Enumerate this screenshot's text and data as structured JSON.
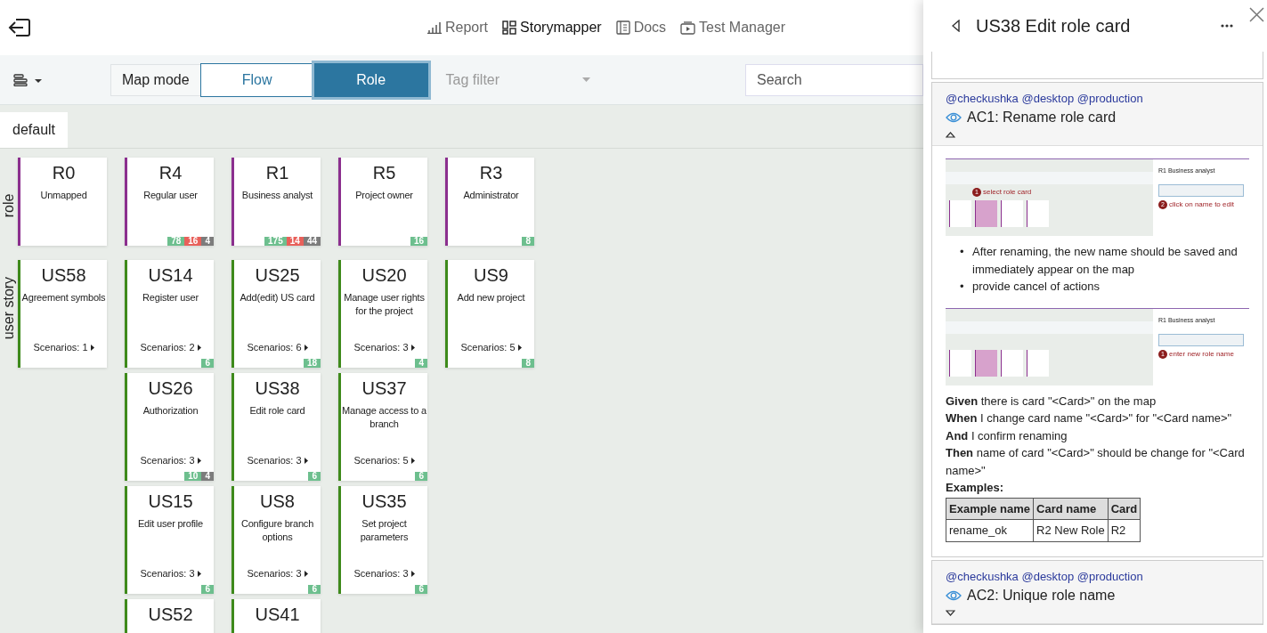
{
  "nav": {
    "links": [
      {
        "label": "Report",
        "selected": false
      },
      {
        "label": "Storymapper",
        "selected": true
      },
      {
        "label": "Docs",
        "selected": false
      },
      {
        "label": "Test Manager",
        "selected": false
      }
    ]
  },
  "toolbar": {
    "map_mode_label": "Map mode",
    "modes": [
      {
        "label": "Flow",
        "selected": false
      },
      {
        "label": "Role",
        "selected": true
      }
    ],
    "tag_filter": {
      "placeholder": "Tag filter"
    },
    "search": {
      "placeholder": "Search"
    }
  },
  "tabs": [
    {
      "label": "default",
      "selected": true
    }
  ],
  "lanes": [
    {
      "label": "role",
      "color": "#8b2f8e",
      "columns": [
        [
          {
            "code": "R0",
            "title": "Unmapped"
          }
        ],
        [
          {
            "code": "R4",
            "title": "Regular user",
            "badges": [
              {
                "kind": "passed",
                "text": "78"
              },
              {
                "kind": "failed",
                "text": "16"
              },
              {
                "kind": "skipped",
                "text": "4"
              }
            ]
          }
        ],
        [
          {
            "code": "R1",
            "title": "Business analyst",
            "badges": [
              {
                "kind": "passed",
                "text": "175"
              },
              {
                "kind": "failed",
                "text": "14"
              },
              {
                "kind": "skipped",
                "text": "44"
              }
            ]
          }
        ],
        [
          {
            "code": "R5",
            "title": "Project owner",
            "badges": [
              {
                "kind": "passed",
                "text": "16"
              }
            ]
          }
        ],
        [
          {
            "code": "R3",
            "title": "Administrator",
            "badges": [
              {
                "kind": "passed",
                "text": "8"
              }
            ]
          }
        ]
      ]
    },
    {
      "label": "user story",
      "color": "#3e8a1b",
      "columns": [
        [
          {
            "code": "US58",
            "title": "Agreement symbols",
            "scenarios": "Scenarios: 1"
          }
        ],
        [
          {
            "code": "US14",
            "title": "Register user",
            "scenarios": "Scenarios: 2",
            "badges": [
              {
                "kind": "passed",
                "text": "6"
              }
            ]
          },
          {
            "code": "US26",
            "title": "Authorization",
            "scenarios": "Scenarios: 3",
            "badges": [
              {
                "kind": "passed",
                "text": "10"
              },
              {
                "kind": "skipped",
                "text": "4"
              }
            ]
          },
          {
            "code": "US15",
            "title": "Edit user profile",
            "scenarios": "Scenarios: 3",
            "badges": [
              {
                "kind": "passed",
                "text": "6"
              }
            ]
          },
          {
            "code": "US52"
          }
        ],
        [
          {
            "code": "US25",
            "title": "Add(edit) US card",
            "scenarios": "Scenarios: 6",
            "badges": [
              {
                "kind": "passed",
                "text": "18"
              }
            ]
          },
          {
            "code": "US38",
            "title": "Edit role card",
            "scenarios": "Scenarios: 3",
            "badges": [
              {
                "kind": "passed",
                "text": "6"
              }
            ]
          },
          {
            "code": "US8",
            "title": "Configure branch options",
            "scenarios": "Scenarios: 3",
            "badges": [
              {
                "kind": "passed",
                "text": "6"
              }
            ]
          },
          {
            "code": "US41"
          }
        ],
        [
          {
            "code": "US20",
            "title": "Manage user rights for the project",
            "scenarios": "Scenarios: 3",
            "badges": [
              {
                "kind": "passed",
                "text": "4"
              }
            ]
          },
          {
            "code": "US37",
            "title": "Manage access to a branch",
            "scenarios": "Scenarios: 5",
            "badges": [
              {
                "kind": "passed",
                "text": "6"
              }
            ]
          },
          {
            "code": "US35",
            "title": "Set project parameters",
            "scenarios": "Scenarios: 3",
            "badges": [
              {
                "kind": "passed",
                "text": "6"
              }
            ]
          }
        ],
        [
          {
            "code": "US9",
            "title": "Add new project",
            "scenarios": "Scenarios: 5",
            "badges": [
              {
                "kind": "passed",
                "text": "8"
              }
            ]
          }
        ]
      ]
    }
  ],
  "detail": {
    "title": "US38 Edit role card",
    "criteria": [
      {
        "tags": "@checkushka @desktop @production",
        "title": "AC1: Rename role card",
        "expanded": true,
        "body": [
          {
            "kind": "screenshot",
            "panel_title": "R1 Business analyst",
            "map_annotations": [
              {
                "number": "1",
                "text": "select role card"
              }
            ],
            "panel_annotations": [
              {
                "number": "2",
                "text": "click on name to edit"
              }
            ]
          },
          {
            "kind": "bullets",
            "items": [
              {
                "marker": "•",
                "text": "After renaming, the new name should be saved and immediately appear on the map"
              },
              {
                "marker": "•",
                "text": "provide cancel of actions"
              }
            ]
          },
          {
            "kind": "screenshot",
            "panel_title": "R1 Business analyst",
            "panel_annotations": [
              {
                "number": "1",
                "text": "enter new role name"
              }
            ]
          },
          {
            "kind": "steps",
            "lines": [
              "**Given** there is card \"<Card>\" on the map",
              "**When** I change card name \"<Card>\" for \"<Card name>\"",
              "**And** I confirm renaming",
              "**Then** name of card \"<Card>\" should be change for \"<Card name>\""
            ]
          },
          {
            "kind": "heading",
            "text": "Examples:"
          },
          {
            "kind": "table",
            "columns": [
              "Example name",
              "Card name",
              "Card"
            ],
            "rows": [
              [
                "rename_ok",
                "R2 New Role",
                "R2"
              ]
            ]
          }
        ]
      },
      {
        "tags": "@checkushka @desktop @production",
        "title": "AC2: Unique role name",
        "expanded": false
      }
    ]
  }
}
